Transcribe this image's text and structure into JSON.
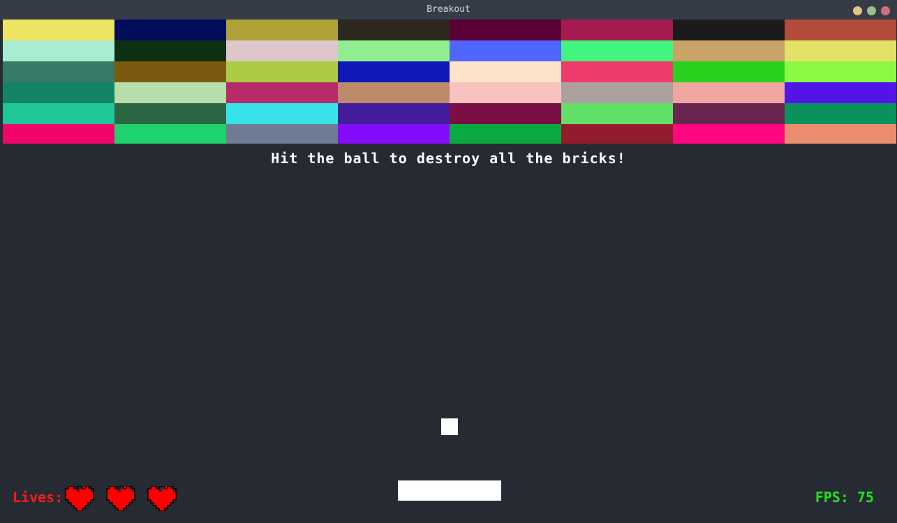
{
  "window": {
    "title": "Breakout",
    "controls": {
      "minimize_color": "#e3c48b",
      "maximize_color": "#9bbf8c",
      "close_color": "#d0707a"
    }
  },
  "game": {
    "message": "Hit the ball to destroy all the bricks!",
    "background_color": "#262a33",
    "bricks": [
      [
        "#ece462",
        "#020d5c",
        "#afa136",
        "#2d281e",
        "#5a0236",
        "#a51b4f",
        "#1b1b1b",
        "#b24b3a"
      ],
      [
        "#a8ecd1",
        "#0d2f13",
        "#dcc8cb",
        "#91ee8f",
        "#5165ff",
        "#42f57e",
        "#c8a266",
        "#e1e166"
      ],
      [
        "#387a68",
        "#7b5a10",
        "#accb45",
        "#1218b6",
        "#fce3c8",
        "#ef3a6c",
        "#29d11f",
        "#8bfa44"
      ],
      [
        "#128569",
        "#b6ddaa",
        "#b72b6a",
        "#bc8a6b",
        "#f9c2bf",
        "#aca19c",
        "#efa6a0",
        "#5314e8"
      ],
      [
        "#1fc798",
        "#2c6643",
        "#37e2ea",
        "#441c9c",
        "#7a0e45",
        "#62df66",
        "#692650",
        "#0a915c"
      ],
      [
        "#f00569",
        "#1fd26e",
        "#6e7b92",
        "#830dfb",
        "#0aaa42",
        "#941b2d",
        "#ff0781",
        "#e98d6e"
      ]
    ],
    "ball_color": "#ffffff",
    "paddle_color": "#ffffff"
  },
  "hud": {
    "lives_label": "Lives:",
    "lives": 3,
    "heart_icon": "heart-icon",
    "heart_color": "#ff0000",
    "fps_label": "FPS: 75",
    "lives_color": "#ff1a1a",
    "fps_color": "#22e022"
  }
}
